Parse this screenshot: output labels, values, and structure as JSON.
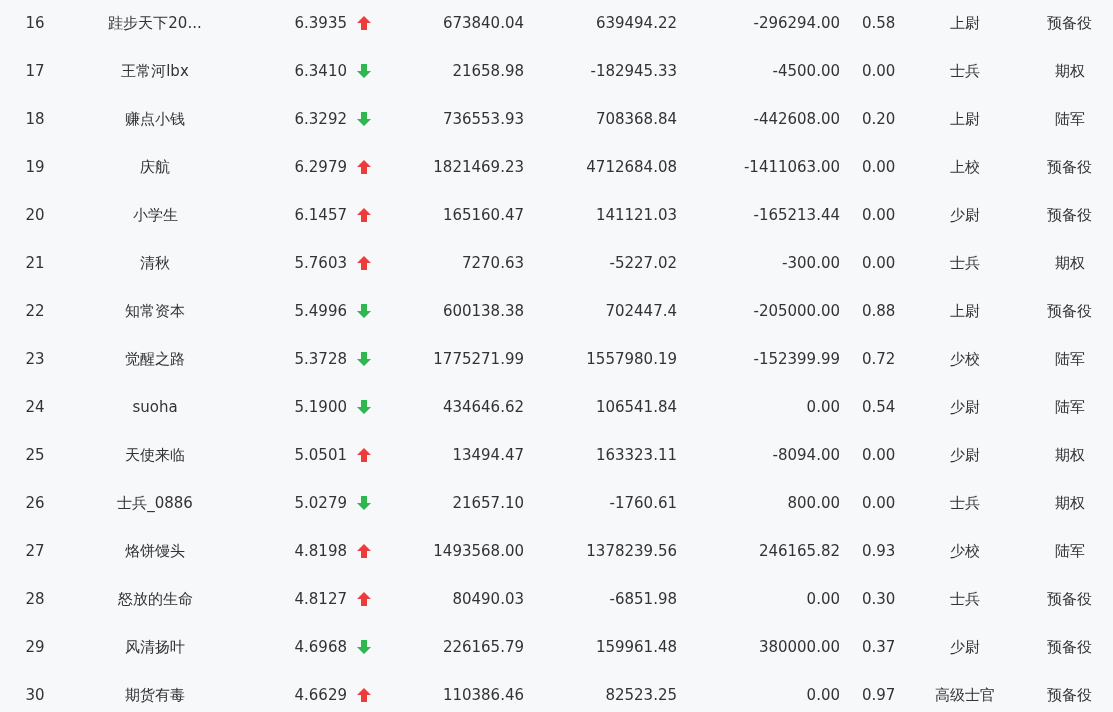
{
  "table": {
    "rows": [
      {
        "rank": "16",
        "name": "跬步天下20...",
        "score": "6.3935",
        "kind": "up",
        "column_4": "673840.04",
        "column_5": "639494.22",
        "column_6": "-296294.00",
        "column_7": "0.58",
        "column_8": "上尉",
        "column_9": "预备役"
      },
      {
        "rank": "17",
        "name": "王常河lbx",
        "score": "6.3410",
        "kind": "down",
        "column_4": "21658.98",
        "column_5": "-182945.33",
        "column_6": "-4500.00",
        "column_7": "0.00",
        "column_8": "士兵",
        "column_9": "期权"
      },
      {
        "rank": "18",
        "name": "赚点小钱",
        "score": "6.3292",
        "kind": "down",
        "column_4": "736553.93",
        "column_5": "708368.84",
        "column_6": "-442608.00",
        "column_7": "0.20",
        "column_8": "上尉",
        "column_9": "陆军"
      },
      {
        "rank": "19",
        "name": "庆航",
        "score": "6.2979",
        "kind": "up",
        "column_4": "1821469.23",
        "column_5": "4712684.08",
        "column_6": "-1411063.00",
        "column_7": "0.00",
        "column_8": "上校",
        "column_9": "预备役"
      },
      {
        "rank": "20",
        "name": "小学生",
        "score": "6.1457",
        "kind": "up",
        "column_4": "165160.47",
        "column_5": "141121.03",
        "column_6": "-165213.44",
        "column_7": "0.00",
        "column_8": "少尉",
        "column_9": "预备役"
      },
      {
        "rank": "21",
        "name": "清秋",
        "score": "5.7603",
        "kind": "up",
        "column_4": "7270.63",
        "column_5": "-5227.02",
        "column_6": "-300.00",
        "column_7": "0.00",
        "column_8": "士兵",
        "column_9": "期权"
      },
      {
        "rank": "22",
        "name": "知常资本",
        "score": "5.4996",
        "kind": "down",
        "column_4": "600138.38",
        "column_5": "702447.4",
        "column_6": "-205000.00",
        "column_7": "0.88",
        "column_8": "上尉",
        "column_9": "预备役"
      },
      {
        "rank": "23",
        "name": "觉醒之路",
        "score": "5.3728",
        "kind": "down",
        "column_4": "1775271.99",
        "column_5": "1557980.19",
        "column_6": "-152399.99",
        "column_7": "0.72",
        "column_8": "少校",
        "column_9": "陆军"
      },
      {
        "rank": "24",
        "name": "suoha",
        "score": "5.1900",
        "kind": "down",
        "column_4": "434646.62",
        "column_5": "106541.84",
        "column_6": "0.00",
        "column_7": "0.54",
        "column_8": "少尉",
        "column_9": "陆军"
      },
      {
        "rank": "25",
        "name": "天使来临",
        "score": "5.0501",
        "kind": "up",
        "column_4": "13494.47",
        "column_5": "163323.11",
        "column_6": "-8094.00",
        "column_7": "0.00",
        "column_8": "少尉",
        "column_9": "期权"
      },
      {
        "rank": "26",
        "name": "士兵_0886",
        "score": "5.0279",
        "kind": "down",
        "column_4": "21657.10",
        "column_5": "-1760.61",
        "column_6": "800.00",
        "column_7": "0.00",
        "column_8": "士兵",
        "column_9": "期权"
      },
      {
        "rank": "27",
        "name": "烙饼馒头",
        "score": "4.8198",
        "kind": "up",
        "column_4": "1493568.00",
        "column_5": "1378239.56",
        "column_6": "246165.82",
        "column_7": "0.93",
        "column_8": "少校",
        "column_9": "陆军"
      },
      {
        "rank": "28",
        "name": "怒放的生命",
        "score": "4.8127",
        "kind": "up",
        "column_4": "80490.03",
        "column_5": "-6851.98",
        "column_6": "0.00",
        "column_7": "0.30",
        "column_8": "士兵",
        "column_9": "预备役"
      },
      {
        "rank": "29",
        "name": "风清扬叶",
        "score": "4.6968",
        "kind": "down",
        "column_4": "226165.79",
        "column_5": "159961.48",
        "column_6": "380000.00",
        "column_7": "0.37",
        "column_8": "少尉",
        "column_9": "预备役"
      },
      {
        "rank": "30",
        "name": "期货有毒",
        "score": "4.6629",
        "kind": "up",
        "column_4": "110386.46",
        "column_5": "82523.25",
        "column_6": "0.00",
        "column_7": "0.97",
        "column_8": "高级士官",
        "column_9": "预备役"
      }
    ]
  }
}
